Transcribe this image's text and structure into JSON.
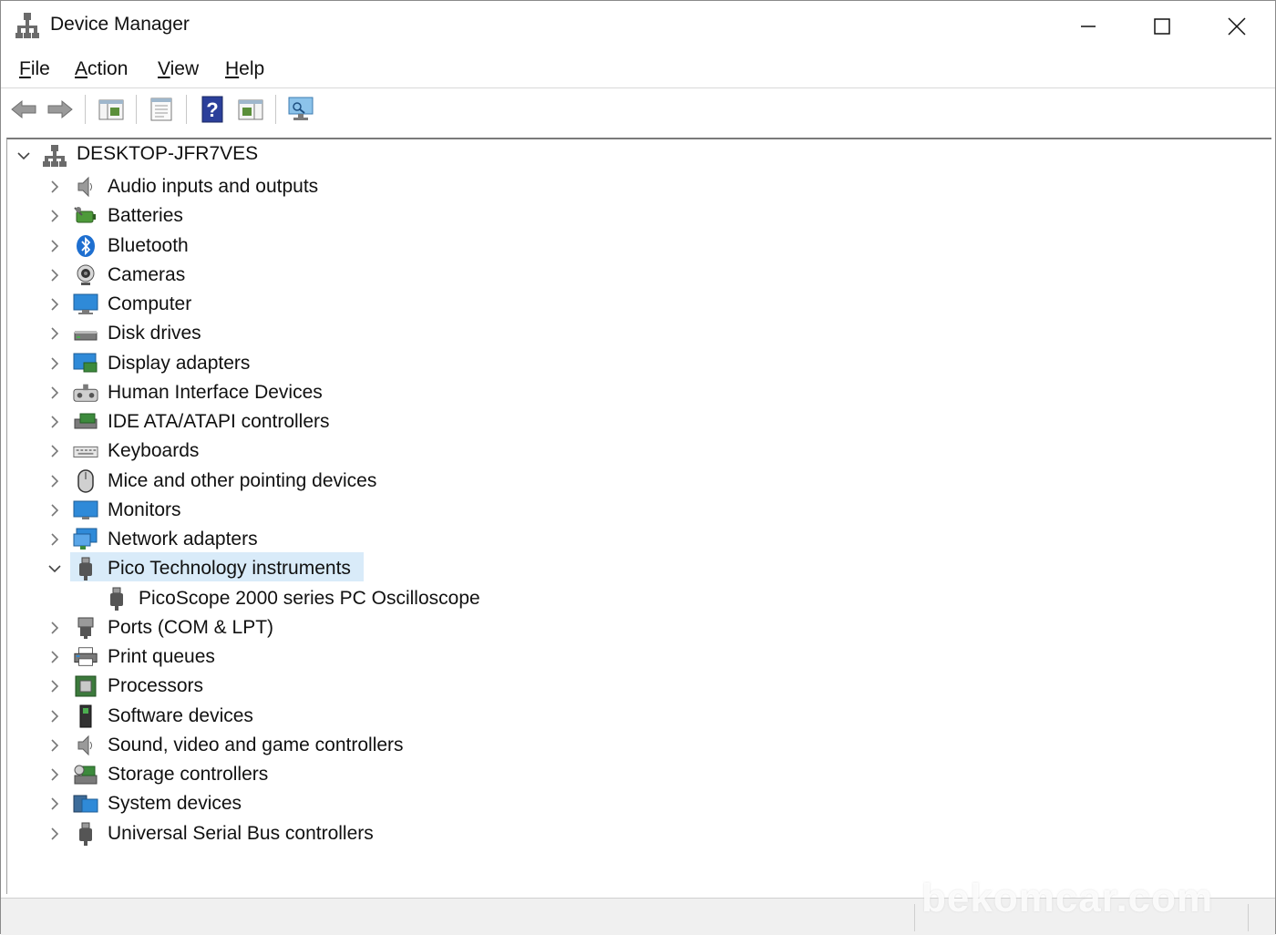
{
  "window": {
    "title": "Device Manager"
  },
  "menu": {
    "items": [
      {
        "accel": "F",
        "rest": "ile"
      },
      {
        "accel": "A",
        "rest": "ction"
      },
      {
        "accel": "V",
        "rest": "iew"
      },
      {
        "accel": "H",
        "rest": "elp"
      }
    ]
  },
  "toolbar": {
    "buttons": [
      "back-arrow-icon",
      "forward-arrow-icon",
      "show-hide-console-tree-icon",
      "properties-icon",
      "help-icon",
      "action-pane-icon",
      "monitor-scan-icon"
    ]
  },
  "tree": {
    "root": "DESKTOP-JFR7VES",
    "categories": [
      "Audio inputs and outputs",
      "Batteries",
      "Bluetooth",
      "Cameras",
      "Computer",
      "Disk drives",
      "Display adapters",
      "Human Interface Devices",
      "IDE ATA/ATAPI controllers",
      "Keyboards",
      "Mice and other pointing devices",
      "Monitors",
      "Network adapters",
      "Pico Technology instruments",
      "Ports (COM & LPT)",
      "Print queues",
      "Processors",
      "Software devices",
      "Sound, video and game controllers",
      "Storage controllers",
      "System devices",
      "Universal Serial Bus controllers"
    ],
    "expanded_child": "PicoScope 2000 series PC Oscilloscope"
  },
  "watermark": "bekomcar.com",
  "colors": {
    "selection": "#d9ebf9",
    "bluetooth": "#1e6fd0",
    "monitor": "#2f8ad8"
  }
}
